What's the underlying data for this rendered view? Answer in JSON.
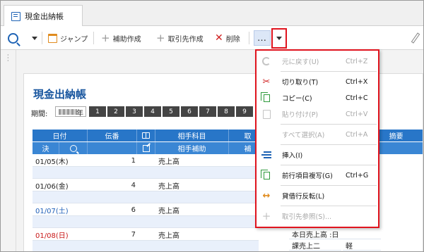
{
  "tab": {
    "title": "現金出納帳"
  },
  "toolbar": {
    "jump_label": "ジャンプ",
    "assist_label": "補助作成",
    "partner_label": "取引先作成",
    "delete_label": "削除",
    "more_label": "…"
  },
  "document": {
    "title": "現金出納帳",
    "period_label": "期間:",
    "year_suffix": "年",
    "months": [
      "1",
      "2",
      "3",
      "4",
      "5",
      "6",
      "7",
      "8",
      "9"
    ]
  },
  "table": {
    "header_row1": {
      "date": "日付",
      "voucher": "伝番",
      "account": "相手科目",
      "middle": "取",
      "summary": "摘要"
    },
    "header_row2": {
      "settle": "決",
      "sub_account": "相手補助",
      "middle": "補"
    },
    "rows": [
      {
        "date": "01/05(木)",
        "date_color": "black",
        "voucher": "1",
        "account": "売上高"
      },
      {
        "date": "01/06(金)",
        "date_color": "black",
        "voucher": "4",
        "account": "売上高"
      },
      {
        "date": "01/07(土)",
        "date_color": "blue",
        "voucher": "6",
        "account": "売上高"
      },
      {
        "date": "01/08(日)",
        "date_color": "red",
        "voucher": "7",
        "account": "売上高"
      }
    ],
    "tip_lines": [
      "本日売上高 :日",
      "課売上二"
    ],
    "tip_extra": "軽"
  },
  "menu": {
    "items": [
      {
        "label": "元に戻す(U)",
        "shortcut": "Ctrl+Z",
        "enabled": false,
        "icon": "undo-icon"
      },
      {
        "label": "切り取り(T)",
        "shortcut": "Ctrl+X",
        "enabled": true,
        "icon": "scissors-icon"
      },
      {
        "label": "コピー(C)",
        "shortcut": "Ctrl+C",
        "enabled": true,
        "icon": "copy-icon"
      },
      {
        "label": "貼り付け(P)",
        "shortcut": "Ctrl+V",
        "enabled": false,
        "icon": "paste-icon"
      },
      {
        "label": "すべて選択(A)",
        "shortcut": "Ctrl+A",
        "enabled": false,
        "icon": ""
      },
      {
        "label": "挿入(I)",
        "shortcut": "",
        "enabled": true,
        "icon": "insert-row-icon"
      },
      {
        "label": "前行項目複写(G)",
        "shortcut": "Ctrl+G",
        "enabled": true,
        "icon": "copy-row-icon"
      },
      {
        "label": "貸借行反転(L)",
        "shortcut": "",
        "enabled": true,
        "icon": "swap-icon"
      },
      {
        "label": "取引先参照(S)...",
        "shortcut": "",
        "enabled": false,
        "icon": "plus-icon"
      }
    ]
  },
  "colors": {
    "accent_blue": "#2876c8",
    "highlight_red": "#e0141e",
    "title_blue": "#16549e"
  }
}
